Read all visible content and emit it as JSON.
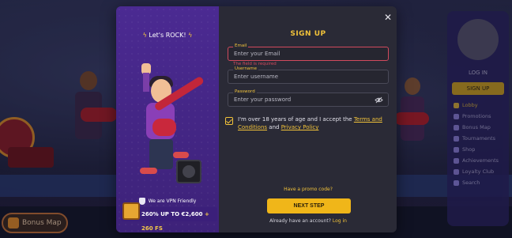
{
  "background": {
    "bonus_map_label": "Bonus Map",
    "sidebar": {
      "login_label": "LOG IN",
      "signup_label": "SIGN UP",
      "items": [
        {
          "label": "Lobby",
          "active": true
        },
        {
          "label": "Promotions"
        },
        {
          "label": "Bonus Map"
        },
        {
          "label": "Tournaments"
        },
        {
          "label": "Shop"
        },
        {
          "label": "Achievements"
        },
        {
          "label": "Loyalty Club"
        }
      ],
      "search_label": "Search"
    }
  },
  "promo": {
    "title": "Let's ROCK!",
    "vpn_text": "We are VPN Friendly",
    "bonus_main": "260% UP TO €2,600",
    "bonus_fs": "+ 260 FS"
  },
  "form": {
    "heading": "SIGN UP",
    "email": {
      "label": "Email",
      "placeholder": "Enter your Email",
      "error": "The field is required"
    },
    "username": {
      "label": "Username",
      "placeholder": "Enter username"
    },
    "password": {
      "label": "Password",
      "placeholder": "Enter your password"
    },
    "agree_prefix": "I'm over 18 years of age and I accept the",
    "terms_link": "Terms and Conditions",
    "and_text": "and",
    "privacy_link": "Privacy Policy",
    "promo_code_link": "Have a promo code?",
    "next_label": "NEXT STEP",
    "have_account": "Already have an account?",
    "login_link": "Log in"
  },
  "colors": {
    "accent": "#f1c23a",
    "error": "#d14a5d",
    "modal_bg": "#2a2a36",
    "promo_bg": "#4b2a92"
  }
}
